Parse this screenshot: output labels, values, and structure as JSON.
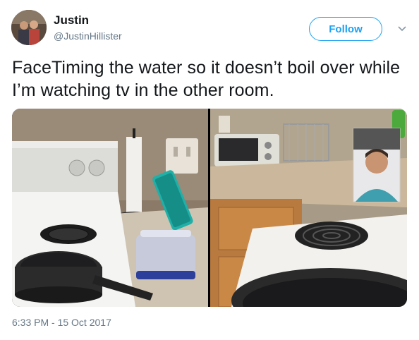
{
  "user": {
    "name": "Justin",
    "handle": "@JustinHillister"
  },
  "actions": {
    "follow_label": "Follow"
  },
  "tweet": {
    "text": "FaceTiming the water so it doesn’t boil over while I’m watching tv in the other room.",
    "timestamp": "6:33 PM - 15 Oct 2017"
  },
  "colors": {
    "accent": "#1da1f2",
    "secondary_text": "#657786"
  },
  "icons": {
    "menu": "chevron-down-icon"
  }
}
